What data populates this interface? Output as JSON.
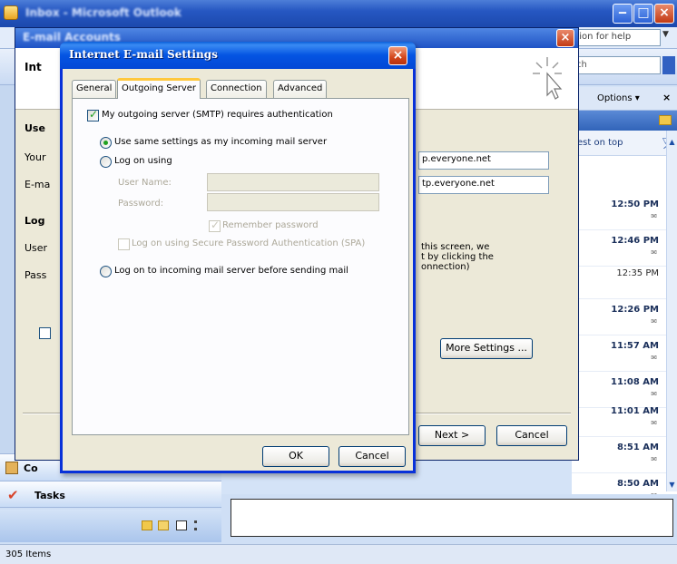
{
  "outlook": {
    "title": "Inbox - Microsoft Outlook",
    "help_placeholder": "estion for help",
    "search_text": "arch",
    "options_label": "Options ▾",
    "arrange_label": "est on top",
    "tasks_label": "Tasks",
    "contacts_label": "Co",
    "status_text": "305 Items",
    "mail_times": [
      {
        "time": "12:50 PM",
        "read": false
      },
      {
        "time": "12:46 PM",
        "read": false
      },
      {
        "time": "12:35 PM",
        "read": true
      },
      {
        "time": "12:26 PM",
        "read": false
      },
      {
        "time": "11:57 AM",
        "read": false
      },
      {
        "time": "11:08 AM",
        "read": false
      },
      {
        "time": "11:01 AM",
        "read": false
      },
      {
        "time": "8:51 AM",
        "read": false
      },
      {
        "time": "8:50 AM",
        "read": false
      }
    ]
  },
  "accounts": {
    "title": "E-mail Accounts",
    "header_partial": "Int",
    "section_user_partial": "Use",
    "label_your_partial": "Your",
    "label_email_partial": "E-ma",
    "section_logon_partial": "Log",
    "label_user_partial": "User",
    "label_pass_partial": "Pass",
    "incoming_server_partial": "p.everyone.net",
    "outgoing_server_partial": "tp.everyone.net",
    "note_text": "this screen, we\nt by clicking the\nonnection)",
    "more_settings_button": "More Settings ...",
    "next_button": "Next >",
    "cancel_button": "Cancel"
  },
  "dialog": {
    "title": "Internet E-mail Settings",
    "tabs": [
      "General",
      "Outgoing Server",
      "Connection",
      "Advanced"
    ],
    "active_tab": "Outgoing Server",
    "smtp_auth_label": "My outgoing server (SMTP) requires authentication",
    "smtp_auth_checked": true,
    "same_settings_label": "Use same settings as my incoming mail server",
    "logon_using_label": "Log on using",
    "username_label": "User Name:",
    "username_value": "",
    "password_label": "Password:",
    "password_value": "",
    "remember_password_label": "Remember password",
    "remember_password_checked": true,
    "spa_label": "Log on using Secure Password Authentication (SPA)",
    "spa_checked": false,
    "logon_incoming_label": "Log on to incoming mail server before sending mail",
    "selected_option": "same_settings",
    "ok_button": "OK",
    "cancel_button": "Cancel"
  }
}
